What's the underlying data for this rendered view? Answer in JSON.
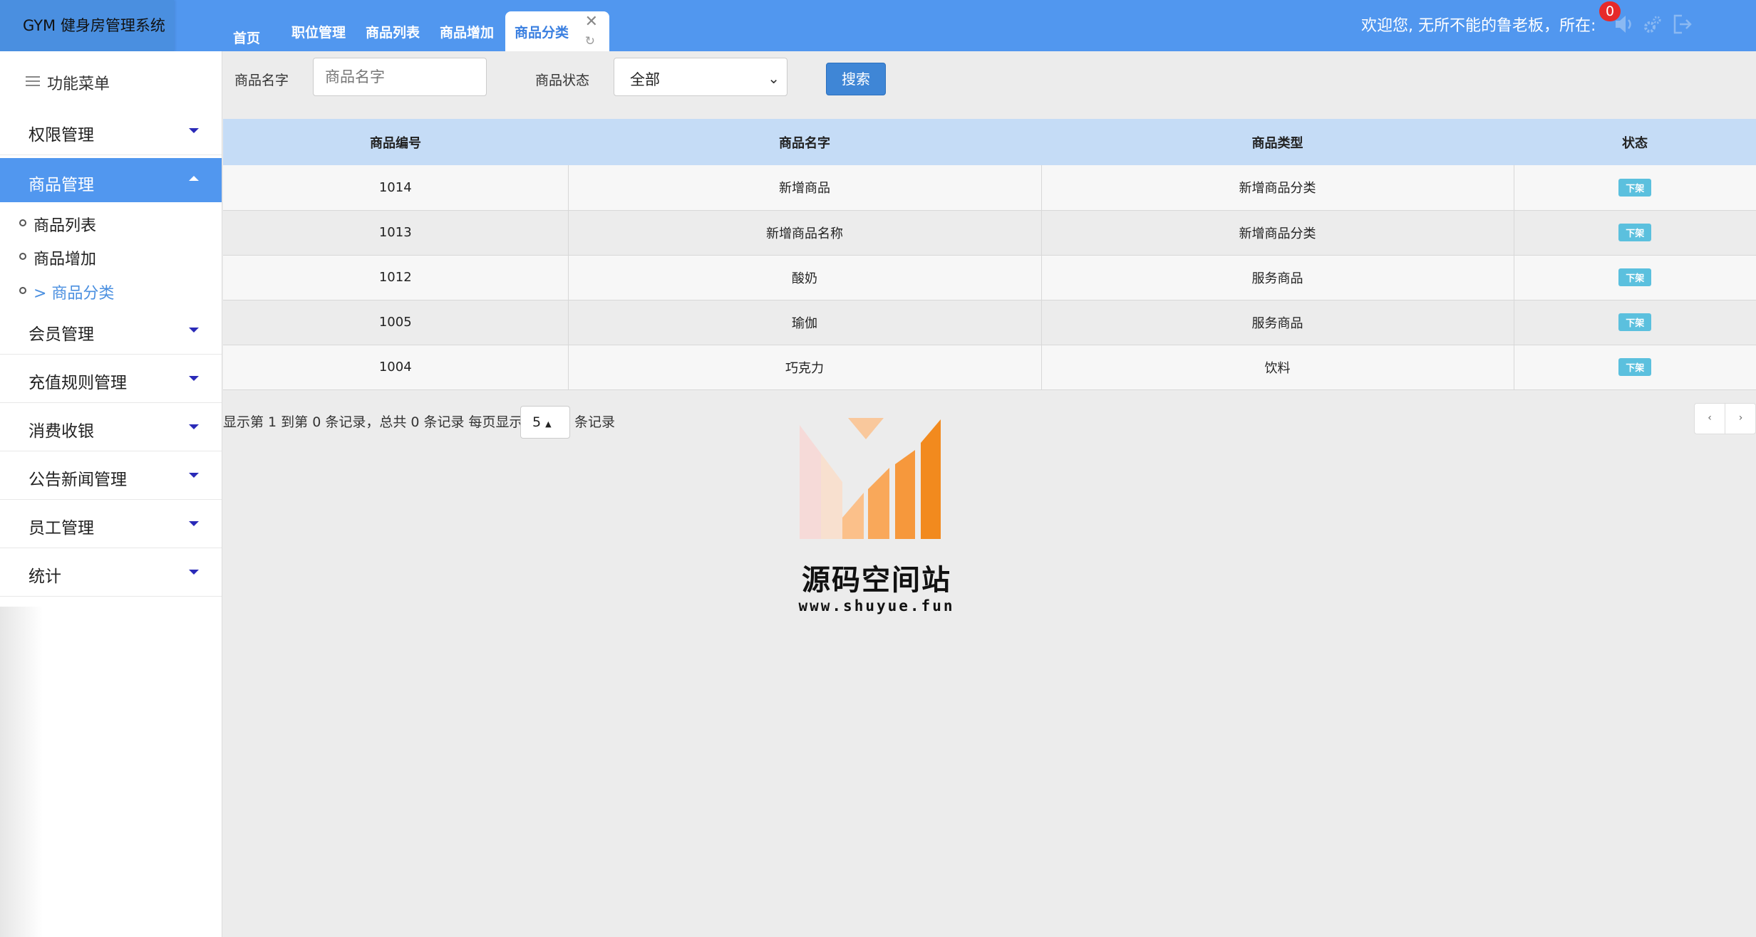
{
  "app": {
    "brand": "GYM 健身房管理系统",
    "welcome": "欢迎您, 无所不能的鲁老板，所在:",
    "notification_count": "0"
  },
  "tabs": [
    {
      "label": "首页"
    },
    {
      "label": "职位管理"
    },
    {
      "label": "商品列表"
    },
    {
      "label": "商品增加"
    },
    {
      "label": "商品分类",
      "active": true
    }
  ],
  "sidebar": {
    "title": "功能菜单",
    "groups": [
      {
        "label": "权限管理"
      },
      {
        "label": "商品管理",
        "expanded": true
      },
      {
        "label": "会员管理"
      },
      {
        "label": "充值规则管理"
      },
      {
        "label": "消费收银"
      },
      {
        "label": "公告新闻管理"
      },
      {
        "label": "员工管理"
      },
      {
        "label": "统计"
      }
    ],
    "sub_items": [
      {
        "label": "商品列表"
      },
      {
        "label": "商品增加"
      },
      {
        "label": "> 商品分类",
        "current": true
      }
    ]
  },
  "filters": {
    "name_label": "商品名字",
    "name_placeholder": "商品名字",
    "status_label": "商品状态",
    "status_value": "全部",
    "search_button": "搜索"
  },
  "table": {
    "headers": [
      "商品编号",
      "商品名字",
      "商品类型",
      "状态"
    ],
    "rows": [
      {
        "id": "1014",
        "name": "新增商品",
        "type": "新增商品分类",
        "status": "下架"
      },
      {
        "id": "1013",
        "name": "新增商品名称",
        "type": "新增商品分类",
        "status": "下架"
      },
      {
        "id": "1012",
        "name": "酸奶",
        "type": "服务商品",
        "status": "下架"
      },
      {
        "id": "1005",
        "name": "瑜伽",
        "type": "服务商品",
        "status": "下架"
      },
      {
        "id": "1004",
        "name": "巧克力",
        "type": "饮料",
        "status": "下架"
      }
    ]
  },
  "pagination": {
    "info": "显示第 1 到第 0 条记录，总共 0 条记录  每页显示",
    "page_size": "5",
    "tail": "条记录",
    "prev": "‹",
    "next": "›"
  },
  "watermark": {
    "text": "源码空间站",
    "url": "www.shuyue.fun"
  },
  "colors": {
    "header": "#5197ef",
    "active_menu": "#5197ef",
    "table_header": "#c5dcf6",
    "status_badge": "#5bc0de",
    "search_button": "#3f86d6"
  }
}
